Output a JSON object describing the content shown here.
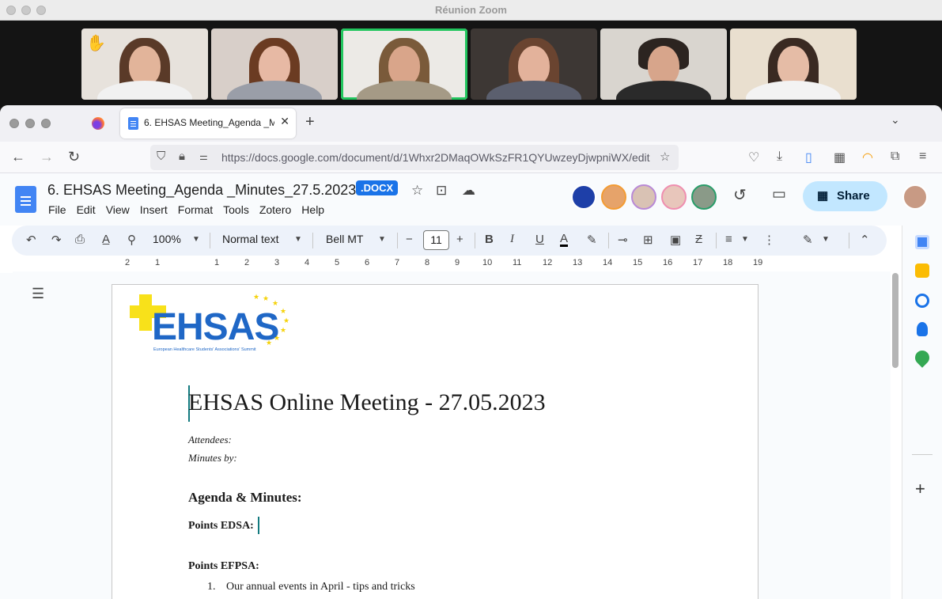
{
  "zoom": {
    "window_title": "Réunion Zoom",
    "participants": [
      {
        "id": "p1",
        "raised_hand": true
      },
      {
        "id": "p2"
      },
      {
        "id": "p3",
        "active_speaker": true
      },
      {
        "id": "p4"
      },
      {
        "id": "p5"
      },
      {
        "id": "p6"
      }
    ]
  },
  "browser": {
    "tab_title": "6. EHSAS Meeting_Agenda _Minutes_27.5.2023",
    "url": "https://docs.google.com/document/d/1Whxr2DMaqOWkSzFR1QYUwzeyDjwpniWX/edit"
  },
  "docs": {
    "title": "6. EHSAS Meeting_Agenda _Minutes_27.5.2023",
    "badge": ".DOCX",
    "menu": [
      "File",
      "Edit",
      "View",
      "Insert",
      "Format",
      "Tools",
      "Zotero",
      "Help"
    ],
    "share_label": "Share",
    "toolbar": {
      "zoom": "100%",
      "style": "Normal text",
      "font": "Bell MT",
      "font_size": "11"
    },
    "ruler": [
      "2",
      "1",
      "1",
      "2",
      "3",
      "4",
      "5",
      "6",
      "7",
      "8",
      "9",
      "10",
      "11",
      "12",
      "13",
      "14",
      "15",
      "16",
      "17",
      "18",
      "19"
    ]
  },
  "document": {
    "logo_text": "EHSAS",
    "logo_subtitle": "European Healthcare Students' Associations' Summit",
    "heading": "EHSAS Online Meeting - 27.05.2023",
    "attendees_label": "Attendees:",
    "minutes_label": "Minutes by:",
    "section_title": "Agenda & Minutes:",
    "points_edsa": "Points EDSA:",
    "points_efpsa": "Points EFPSA:",
    "list_items": [
      {
        "number": "1.",
        "text": "Our annual events in April - tips and tricks"
      }
    ]
  },
  "colors": {
    "accent": "#1a73e8",
    "share_bg": "#c2e7ff",
    "speaker_outline": "#22c55e",
    "logo_blue": "#1f67c6",
    "logo_yellow": "#f8e11a"
  }
}
